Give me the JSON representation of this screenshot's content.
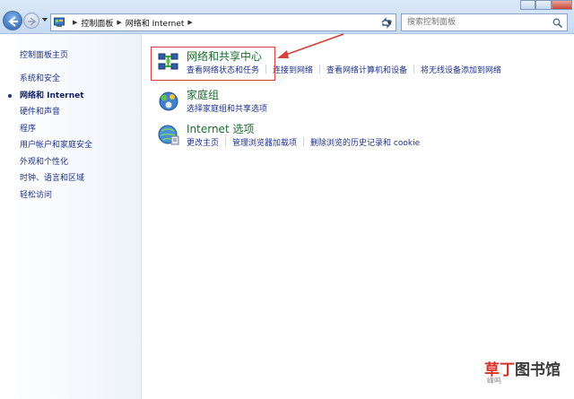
{
  "address_bar": {
    "crumbs": [
      "控制面板",
      "网络和 Internet"
    ]
  },
  "search": {
    "placeholder": "搜索控制面板"
  },
  "left_nav": {
    "home": "控制面板主页",
    "items": [
      {
        "label": "系统和安全",
        "active": false
      },
      {
        "label": "网络和 Internet",
        "active": true
      },
      {
        "label": "硬件和声音",
        "active": false
      },
      {
        "label": "程序",
        "active": false
      },
      {
        "label": "用户帐户和家庭安全",
        "active": false
      },
      {
        "label": "外观和个性化",
        "active": false
      },
      {
        "label": "时钟、语言和区域",
        "active": false
      },
      {
        "label": "轻松访问",
        "active": false
      }
    ]
  },
  "categories": [
    {
      "title": "网络和共享中心",
      "icon": "network-sharing-icon",
      "links": [
        "查看网络状态和任务",
        "连接到网络",
        "查看网络计算机和设备",
        "将无线设备添加到网络"
      ]
    },
    {
      "title": "家庭组",
      "icon": "homegroup-icon",
      "links": [
        "选择家庭组和共享选项"
      ]
    },
    {
      "title": "Internet 选项",
      "icon": "internet-options-icon",
      "links": [
        "更改主页",
        "管理浏览器加载项",
        "删除浏览的历史记录和 cookie"
      ]
    }
  ],
  "watermark": {
    "part_a": "草丁",
    "part_b": "图书馆",
    "sub": "峰鸣"
  },
  "colors": {
    "link": "#1e3287",
    "category_title": "#1d6b32",
    "highlight": "#d6403a"
  }
}
